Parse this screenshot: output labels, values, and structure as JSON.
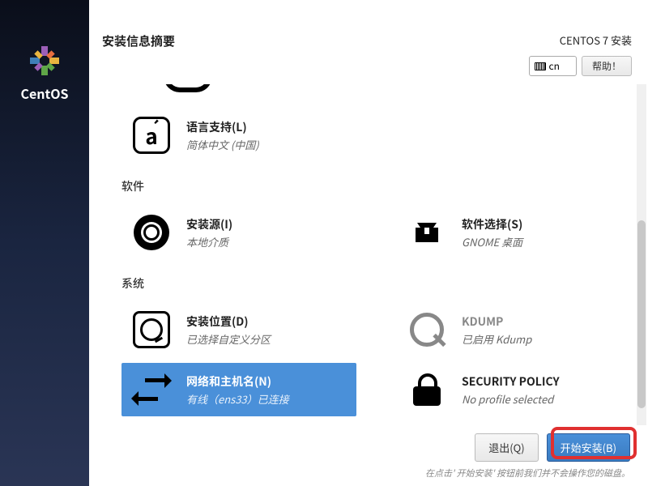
{
  "brand": {
    "name": "CentOS"
  },
  "header": {
    "title": "安装信息摘要",
    "distro": "CENTOS 7 安装",
    "lang_code": "cn",
    "help_label": "帮助！"
  },
  "sections": {
    "partial_icon_hint": "localization-continued",
    "localization": {
      "lang_support": {
        "title": "语言支持(L)",
        "sub": "简体中文 (中国)"
      }
    },
    "software": {
      "label": "软件",
      "source": {
        "title": "安装源(I)",
        "sub": "本地介质"
      },
      "selection": {
        "title": "软件选择(S)",
        "sub": "GNOME 桌面"
      }
    },
    "system": {
      "label": "系统",
      "destination": {
        "title": "安装位置(D)",
        "sub": "已选择自定义分区"
      },
      "kdump": {
        "title": "KDUMP",
        "sub": "已启用 Kdump"
      },
      "network": {
        "title": "网络和主机名(N)",
        "sub": "有线（ens33）已连接"
      },
      "security": {
        "title": "SECURITY POLICY",
        "sub": "No profile selected"
      }
    }
  },
  "footer": {
    "quit_label": "退出(Q)",
    "begin_label": "开始安装(B)",
    "hint": "在点击' 开始安装' 按钮前我们并不会操作您的磁盘。"
  }
}
